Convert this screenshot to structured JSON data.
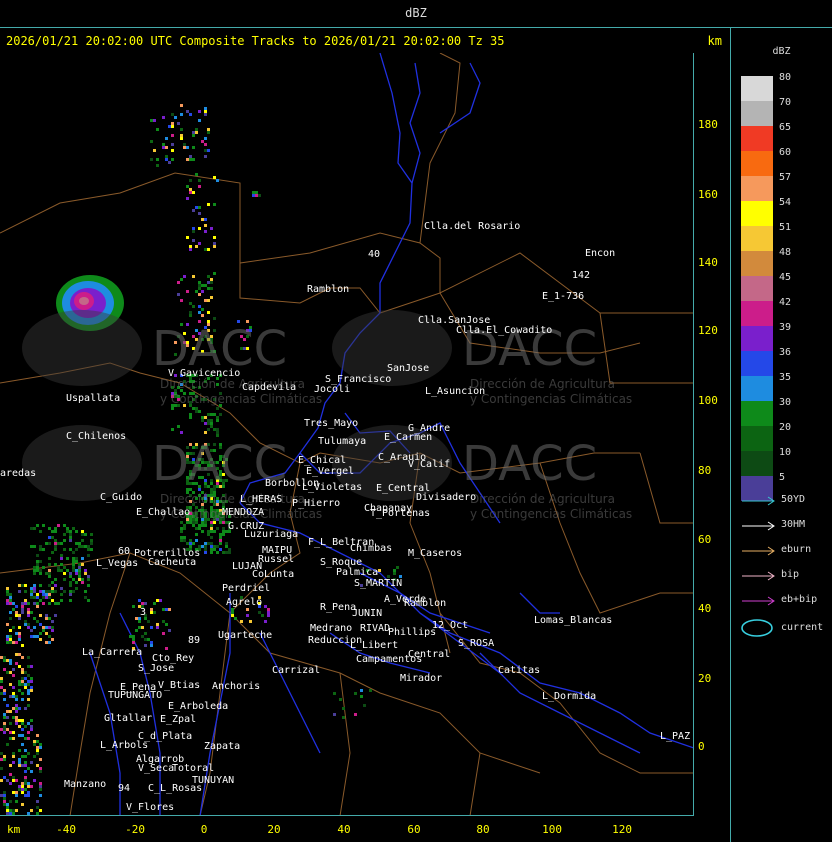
{
  "top_title": "dBZ",
  "header": {
    "title": "2026/01/21 20:02:00 UTC Composite Tracks to 2026/01/21 20:02:00 Tz 35",
    "unit": "km"
  },
  "axes": {
    "y_ticks": [
      "180",
      "160",
      "140",
      "120",
      "100",
      "80",
      "60",
      "40",
      "20",
      "0"
    ],
    "x_ticks": [
      "-40",
      "-20",
      "0",
      "20",
      "40",
      "60",
      "80",
      "100",
      "120"
    ],
    "x_unit": "km"
  },
  "legend": {
    "title": "dBZ",
    "scale": [
      {
        "label": "80",
        "color": "#d8d8d8"
      },
      {
        "label": "70",
        "color": "#b4b4b4"
      },
      {
        "label": "65",
        "color": "#f03a24"
      },
      {
        "label": "60",
        "color": "#f86a10"
      },
      {
        "label": "57",
        "color": "#f6995c"
      },
      {
        "label": "54",
        "color": "#ffff00"
      },
      {
        "label": "51",
        "color": "#f6c834"
      },
      {
        "label": "48",
        "color": "#d28a3c"
      },
      {
        "label": "45",
        "color": "#c46888"
      },
      {
        "label": "42",
        "color": "#cc1d8a"
      },
      {
        "label": "39",
        "color": "#7a1fcc"
      },
      {
        "label": "36",
        "color": "#2448e8"
      },
      {
        "label": "35",
        "color": "#1e8ce0"
      },
      {
        "label": "30",
        "color": "#0e8a1a"
      },
      {
        "label": "20",
        "color": "#0c6412"
      },
      {
        "label": "10",
        "color": "#0d4a14"
      },
      {
        "label": "5",
        "color": "#4a3e98"
      }
    ],
    "tracks": [
      {
        "label": "50YD",
        "color": "#38c8d0"
      },
      {
        "label": "30HM",
        "color": "#ffffff"
      },
      {
        "label": "eburn",
        "color": "#e8b064"
      },
      {
        "label": "bip",
        "color": "#f0b4c8"
      },
      {
        "label": "eb+bip",
        "color": "#d040d0"
      }
    ],
    "current_label": "current",
    "current_color": "#38d0e0"
  },
  "places": [
    {
      "name": "Clla.del Rosario"
    },
    {
      "name": "Encon"
    },
    {
      "name": "142"
    },
    {
      "name": "E_1-736"
    },
    {
      "name": "Ramblon"
    },
    {
      "name": "Clla.SanJose"
    },
    {
      "name": "Clla.El_Cowadito"
    },
    {
      "name": "V Gavicencio"
    },
    {
      "name": "Capdevila"
    },
    {
      "name": "Jocoli"
    },
    {
      "name": "S_Francisco"
    },
    {
      "name": "SanJose"
    },
    {
      "name": "L_Asuncion"
    },
    {
      "name": "Uspallata"
    },
    {
      "name": "Tres_Mayo"
    },
    {
      "name": "G_Andre"
    },
    {
      "name": "C_Chilenos"
    },
    {
      "name": "Tulumaya"
    },
    {
      "name": "E_Carmen"
    },
    {
      "name": "E_Chical"
    },
    {
      "name": "C_Arauio"
    },
    {
      "name": "V_Calif"
    },
    {
      "name": "aredas"
    },
    {
      "name": "E_Vergel"
    },
    {
      "name": "Borbollon"
    },
    {
      "name": "L_Violetas"
    },
    {
      "name": "E_Central"
    },
    {
      "name": "Divisadero"
    },
    {
      "name": "C_Guido"
    },
    {
      "name": "L_HERAS"
    },
    {
      "name": "P_Hierro"
    },
    {
      "name": "E_Challao"
    },
    {
      "name": "MENDOZA"
    },
    {
      "name": "T_Portenas"
    },
    {
      "name": "G.CRUZ"
    },
    {
      "name": "Luzuriaga"
    },
    {
      "name": "Chapanay"
    },
    {
      "name": "F_L_Beltran"
    },
    {
      "name": "Potrerillos"
    },
    {
      "name": "MAIPU"
    },
    {
      "name": "Chimbas"
    },
    {
      "name": "M_Caseros"
    },
    {
      "name": "L_Vegas"
    },
    {
      "name": "Cacheuta"
    },
    {
      "name": "Russel"
    },
    {
      "name": "S_Roque"
    },
    {
      "name": "LUJAN"
    },
    {
      "name": "Palmica"
    },
    {
      "name": "CoLunta"
    },
    {
      "name": "S_MARTIN"
    },
    {
      "name": "Perdriel"
    },
    {
      "name": "A_Verde"
    },
    {
      "name": "Ramblon"
    },
    {
      "name": "Agrelo"
    },
    {
      "name": "R_Pena"
    },
    {
      "name": "JUNIN"
    },
    {
      "name": "12_Oct"
    },
    {
      "name": "Lomas_Blancas"
    },
    {
      "name": "Medrano"
    },
    {
      "name": "RIVAD"
    },
    {
      "name": "Phillips"
    },
    {
      "name": "Ugarteche"
    },
    {
      "name": "Reduccion"
    },
    {
      "name": "S_ROSA"
    },
    {
      "name": "L_Libert"
    },
    {
      "name": "La_Carrera"
    },
    {
      "name": "Campamentos"
    },
    {
      "name": "Central"
    },
    {
      "name": "Cto_Rey"
    },
    {
      "name": "S_Jose"
    },
    {
      "name": "Carrizal"
    },
    {
      "name": "Catitas"
    },
    {
      "name": "Mirador"
    },
    {
      "name": "V_Btias"
    },
    {
      "name": "Anchoris"
    },
    {
      "name": "E_Pena"
    },
    {
      "name": "TUPUNGATO"
    },
    {
      "name": "L_Dormida"
    },
    {
      "name": "E_Arboleda"
    },
    {
      "name": "Gltallar"
    },
    {
      "name": "E_Zpal"
    },
    {
      "name": "C_d_Plata"
    },
    {
      "name": "L_PAZ"
    },
    {
      "name": "L_Arbols"
    },
    {
      "name": "Zapata"
    },
    {
      "name": "Algarrob"
    },
    {
      "name": "V_Seca"
    },
    {
      "name": "Totoral"
    },
    {
      "name": "TUNUYAN"
    },
    {
      "name": "Manzano"
    },
    {
      "name": "C_L_Rosas"
    },
    {
      "name": "V_Flores"
    },
    {
      "name": "40"
    },
    {
      "name": "94"
    },
    {
      "name": "60"
    },
    {
      "name": "89"
    },
    {
      "name": "3"
    }
  ],
  "watermark": {
    "brand": "DACC",
    "line1": "Dirección de Agricultura",
    "line2": "y Contingencias Climáticas"
  }
}
